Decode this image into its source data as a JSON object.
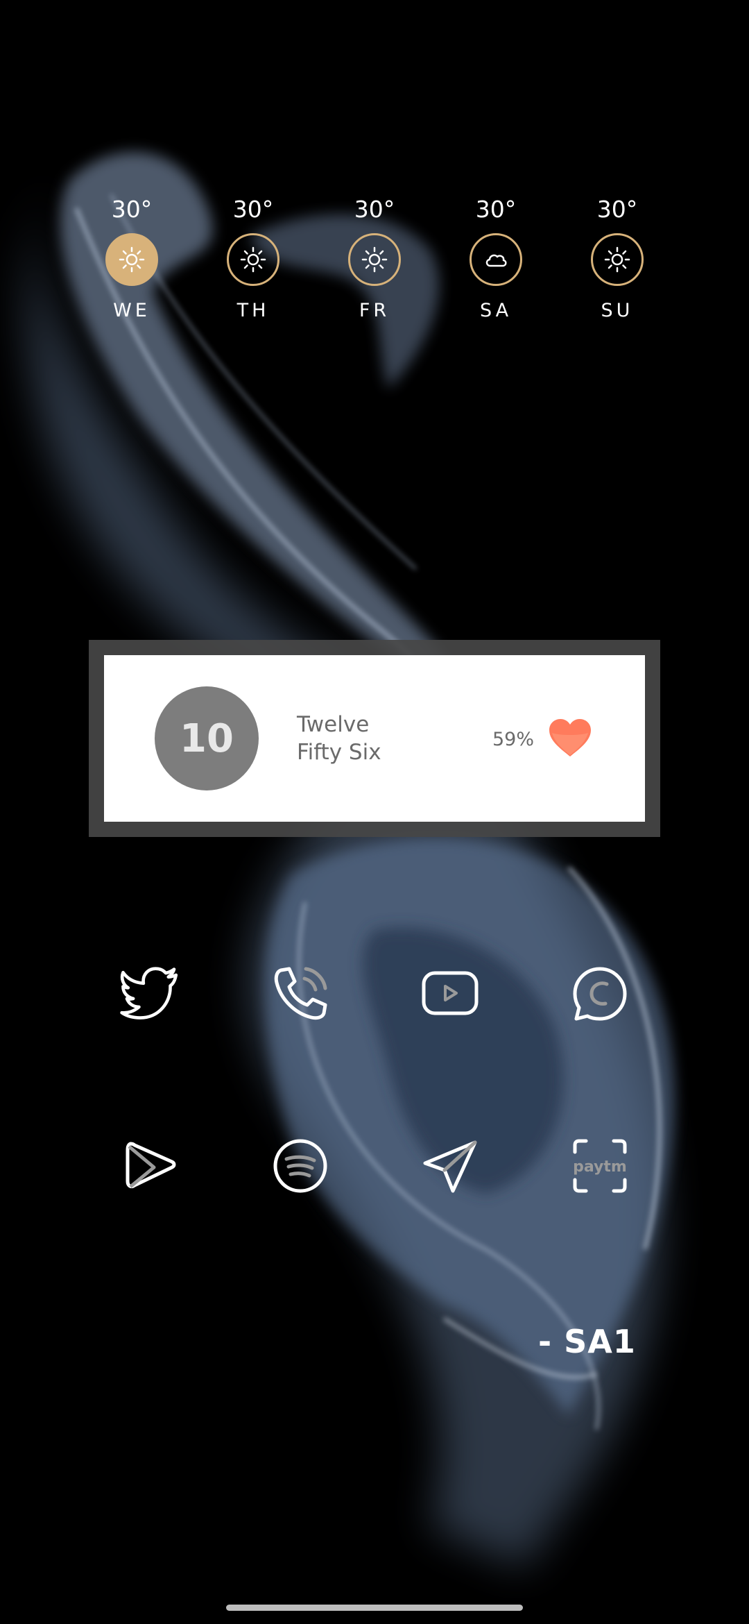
{
  "weather": {
    "days": [
      {
        "temp": "30°",
        "day": "WE",
        "icon": "sun-icon",
        "active": true
      },
      {
        "temp": "30°",
        "day": "TH",
        "icon": "sun-icon",
        "active": false
      },
      {
        "temp": "30°",
        "day": "FR",
        "icon": "sun-icon",
        "active": false
      },
      {
        "temp": "30°",
        "day": "SA",
        "icon": "cloud-icon",
        "active": false
      },
      {
        "temp": "30°",
        "day": "SU",
        "icon": "sun-icon",
        "active": false
      }
    ],
    "accent": "#d8b27a"
  },
  "widget": {
    "number": "10",
    "time_line1": "Twelve",
    "time_line2": "Fifty Six",
    "battery": "59%",
    "heart_color": "#ff7b5c"
  },
  "apps": [
    {
      "name": "twitter",
      "icon": "twitter-icon"
    },
    {
      "name": "phone",
      "icon": "phone-icon"
    },
    {
      "name": "youtube",
      "icon": "youtube-icon"
    },
    {
      "name": "whatsapp",
      "icon": "whatsapp-icon"
    },
    {
      "name": "play-store",
      "icon": "play-store-icon"
    },
    {
      "name": "spotify",
      "icon": "spotify-icon"
    },
    {
      "name": "telegram",
      "icon": "telegram-icon"
    },
    {
      "name": "paytm",
      "icon": "paytm-icon",
      "label": "paytm"
    }
  ],
  "signature": "- SA1"
}
